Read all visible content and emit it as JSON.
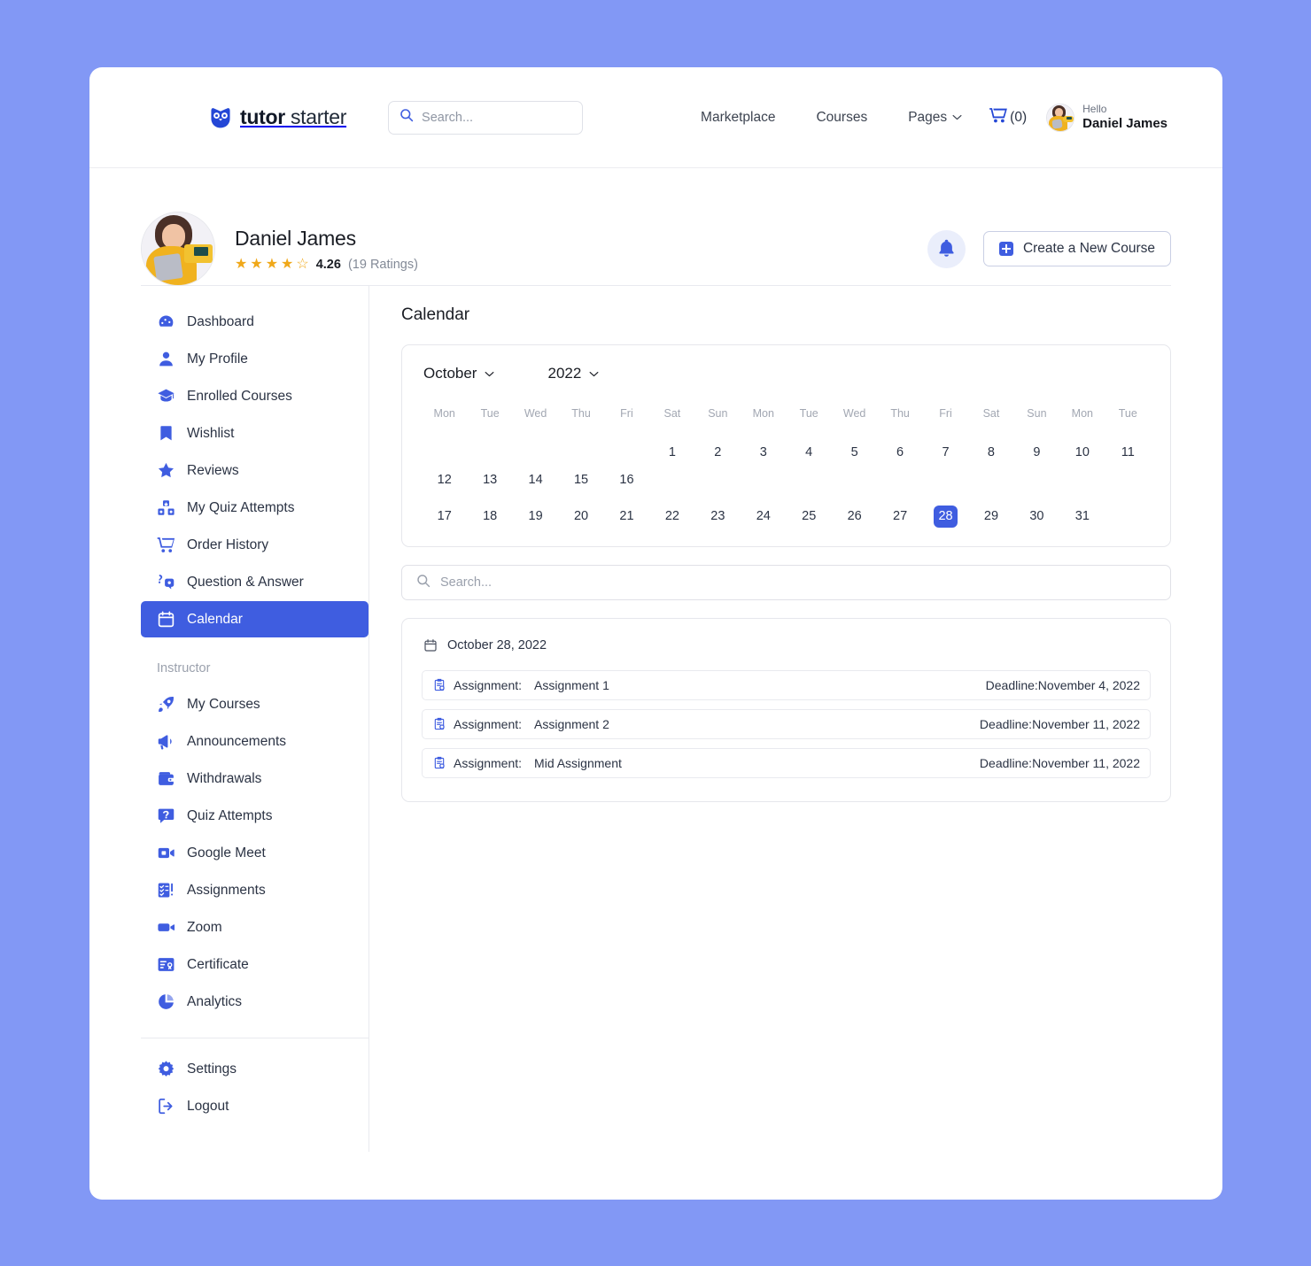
{
  "brand": {
    "name_bold": "tutor",
    "name_light": " starter",
    "icon": "owl-icon"
  },
  "header": {
    "search_placeholder": "Search...",
    "search_value": "",
    "nav": [
      {
        "label": "Marketplace",
        "name": "nav-marketplace",
        "caret": false
      },
      {
        "label": "Courses",
        "name": "nav-courses",
        "caret": false
      },
      {
        "label": "Pages",
        "name": "nav-pages",
        "caret": true
      }
    ],
    "cart_label": "(0)",
    "greeting": "Hello",
    "user_name": "Daniel James"
  },
  "profile": {
    "name": "Daniel James",
    "rating_value": "4.26",
    "rating_count": "(19 Ratings)",
    "stars_filled": 4,
    "stars_total": 5,
    "notification_icon": "bell-icon",
    "create_course_label": "Create a New Course"
  },
  "sidebar": {
    "items": [
      {
        "label": "Dashboard",
        "icon": "dashboard-icon",
        "name": "sidebar-item-dashboard",
        "active": false
      },
      {
        "label": "My Profile",
        "icon": "user-icon",
        "name": "sidebar-item-my-profile",
        "active": false
      },
      {
        "label": "Enrolled Courses",
        "icon": "graduation-cap-icon",
        "name": "sidebar-item-enrolled-courses",
        "active": false
      },
      {
        "label": "Wishlist",
        "icon": "bookmark-icon",
        "name": "sidebar-item-wishlist",
        "active": false
      },
      {
        "label": "Reviews",
        "icon": "star-icon",
        "name": "sidebar-item-reviews",
        "active": false
      },
      {
        "label": "My Quiz Attempts",
        "icon": "quiz-blocks-icon",
        "name": "sidebar-item-my-quiz-attempts",
        "active": false
      },
      {
        "label": "Order History",
        "icon": "cart-icon",
        "name": "sidebar-item-order-history",
        "active": false
      },
      {
        "label": "Question & Answer",
        "icon": "question-answer-icon",
        "name": "sidebar-item-question-answer",
        "active": false
      },
      {
        "label": "Calendar",
        "icon": "calendar-icon",
        "name": "sidebar-item-calendar",
        "active": true
      }
    ],
    "instructor_title": "Instructor",
    "instructor_items": [
      {
        "label": "My Courses",
        "icon": "rocket-icon",
        "name": "sidebar-item-my-courses"
      },
      {
        "label": "Announcements",
        "icon": "megaphone-icon",
        "name": "sidebar-item-announcements"
      },
      {
        "label": "Withdrawals",
        "icon": "wallet-icon",
        "name": "sidebar-item-withdrawals"
      },
      {
        "label": "Quiz Attempts",
        "icon": "question-box-icon",
        "name": "sidebar-item-quiz-attempts"
      },
      {
        "label": "Google Meet",
        "icon": "video-camera-icon",
        "name": "sidebar-item-google-meet"
      },
      {
        "label": "Assignments",
        "icon": "checklist-icon",
        "name": "sidebar-item-assignments"
      },
      {
        "label": "Zoom",
        "icon": "video-icon",
        "name": "sidebar-item-zoom"
      },
      {
        "label": "Certificate",
        "icon": "certificate-icon",
        "name": "sidebar-item-certificate"
      },
      {
        "label": "Analytics",
        "icon": "pie-chart-icon",
        "name": "sidebar-item-analytics"
      }
    ],
    "footer_items": [
      {
        "label": "Settings",
        "icon": "gear-icon",
        "name": "sidebar-item-settings"
      },
      {
        "label": "Logout",
        "icon": "logout-icon",
        "name": "sidebar-item-logout"
      }
    ]
  },
  "main": {
    "title": "Calendar",
    "calendar": {
      "month": "October",
      "year": "2022",
      "selected_day": "28",
      "weekday_labels": [
        "Mon",
        "Tue",
        "Wed",
        "Thu",
        "Fri",
        "Sat",
        "Sun",
        "Mon",
        "Tue",
        "Wed",
        "Thu",
        "Fri",
        "Sat",
        "Sun",
        "Mon",
        "Tue",
        "Wed",
        "Thu",
        "Fri",
        "Sat",
        "Sun",
        "Mon",
        "Tue",
        "Wed",
        "Thu",
        "Fri",
        "Sat",
        "Sun",
        "Mon",
        "Tue",
        "Wed"
      ],
      "row1_dow": [
        "Mon",
        "Tue",
        "Wed",
        "Thu",
        "Fri",
        "Sat",
        "Sun",
        "Mon",
        "Tue",
        "Wed",
        "Thu",
        "Fri",
        "Sat",
        "Sun",
        "Mon",
        "Tue"
      ],
      "row1_days": [
        "",
        "",
        "",
        "",
        "",
        "1",
        "2",
        "3",
        "4",
        "5",
        "6",
        "7",
        "8",
        "9",
        "10",
        "11",
        "12",
        "13",
        "14",
        "15",
        "16"
      ],
      "row1_days_aligned": [
        "",
        "",
        "",
        "",
        "",
        "1",
        "2",
        "3",
        "4",
        "5",
        "6",
        "7",
        "8",
        "9",
        "10",
        "11"
      ],
      "row2_days": [
        "17",
        "18",
        "19",
        "20",
        "21",
        "22",
        "23",
        "24",
        "25",
        "26",
        "27",
        "28",
        "29",
        "30",
        "31"
      ],
      "days_week1": [
        "",
        "",
        "",
        "",
        "",
        "1",
        "2",
        "3",
        "4",
        "5",
        "6",
        "7",
        "8",
        "9",
        "10",
        "11",
        "12",
        "13",
        "14",
        "15",
        "16"
      ],
      "days_week2": [
        "17",
        "18",
        "19",
        "20",
        "21",
        "22",
        "23",
        "24",
        "25",
        "26",
        "27",
        "28",
        "29",
        "30",
        "31"
      ]
    },
    "search_placeholder": "Search...",
    "search_value": "",
    "events_date": "October 28, 2022",
    "events": [
      {
        "type_label": "Assignment:",
        "title": "Assignment 1",
        "deadline": "Deadline:November 4, 2022"
      },
      {
        "type_label": "Assignment:",
        "title": "Assignment 2",
        "deadline": "Deadline:November 11, 2022"
      },
      {
        "type_label": "Assignment:",
        "title": "Mid Assignment",
        "deadline": "Deadline:November 11, 2022"
      }
    ]
  },
  "colors": {
    "page_background": "#8298f5",
    "accent": "#3f5de0",
    "star": "#f0a819",
    "text": "#2b3344",
    "muted": "#9ba1ad"
  }
}
